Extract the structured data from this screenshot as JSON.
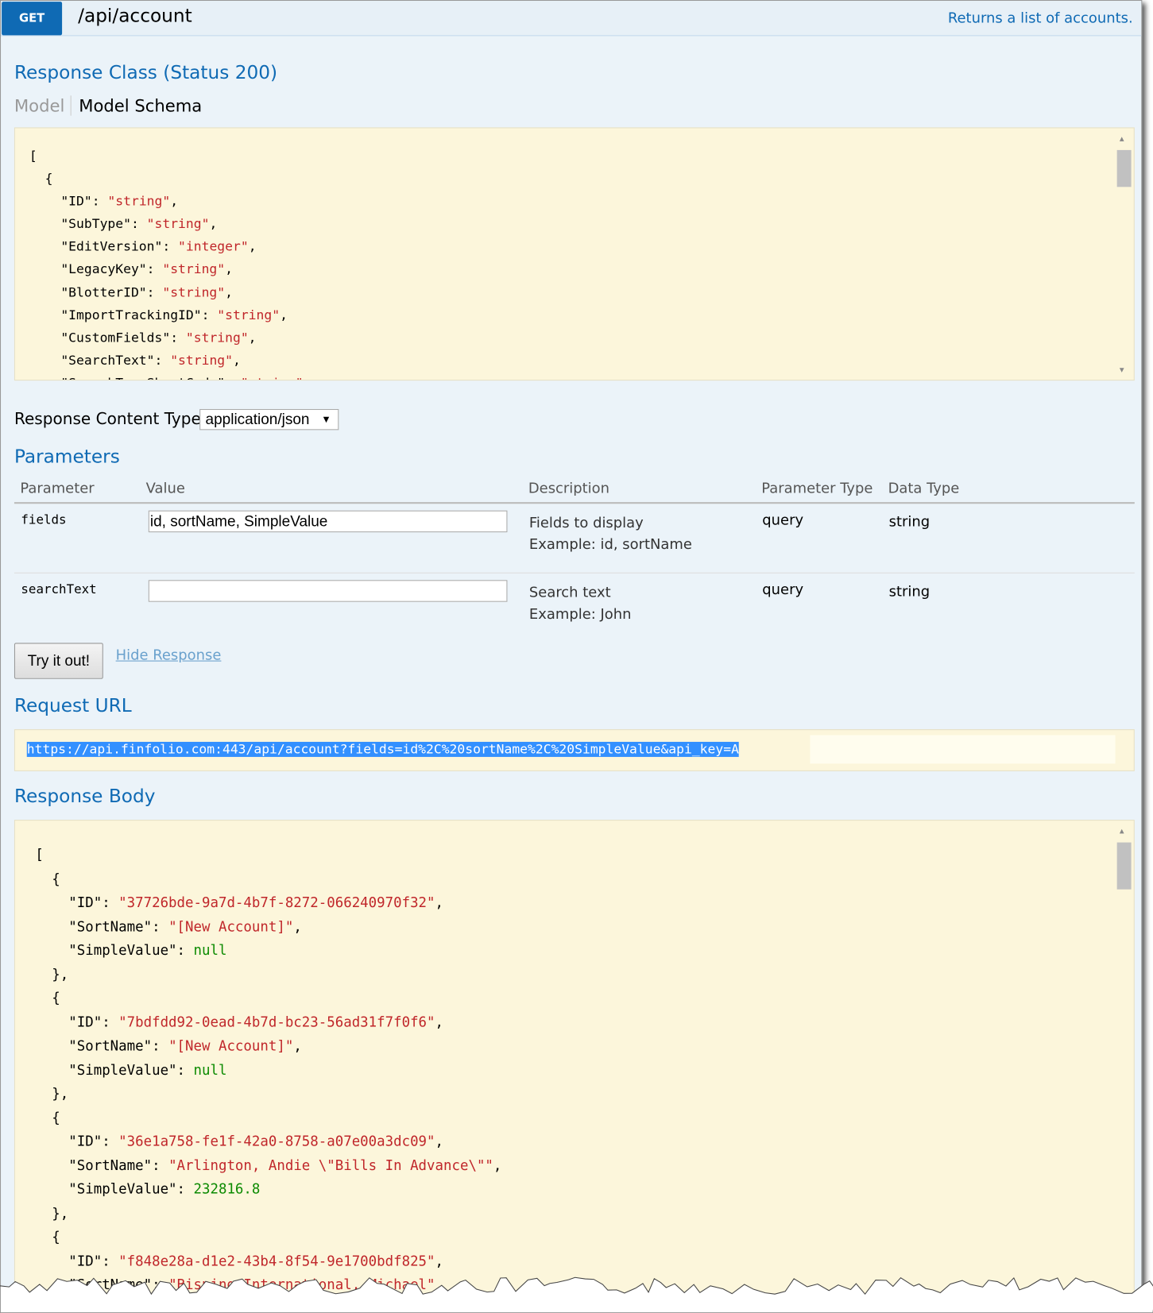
{
  "header": {
    "method": "GET",
    "path": "/api/account",
    "description": "Returns a list of accounts.",
    "method_color": "#0f6ab4"
  },
  "response_class": {
    "title": "Response Class (Status 200)",
    "tabs": [
      "Model",
      "Model Schema"
    ],
    "schema_lines": [
      [
        [
          "[",
          ""
        ]
      ],
      [
        [
          "  {",
          ""
        ]
      ],
      [
        [
          "    \"ID\": ",
          ""
        ],
        [
          "\"string\"",
          "s"
        ],
        [
          ",",
          ""
        ]
      ],
      [
        [
          "    \"SubType\": ",
          ""
        ],
        [
          "\"string\"",
          "s"
        ],
        [
          ",",
          ""
        ]
      ],
      [
        [
          "    \"EditVersion\": ",
          ""
        ],
        [
          "\"integer\"",
          "s"
        ],
        [
          ",",
          ""
        ]
      ],
      [
        [
          "    \"LegacyKey\": ",
          ""
        ],
        [
          "\"string\"",
          "s"
        ],
        [
          ",",
          ""
        ]
      ],
      [
        [
          "    \"BlotterID\": ",
          ""
        ],
        [
          "\"string\"",
          "s"
        ],
        [
          ",",
          ""
        ]
      ],
      [
        [
          "    \"ImportTrackingID\": ",
          ""
        ],
        [
          "\"string\"",
          "s"
        ],
        [
          ",",
          ""
        ]
      ],
      [
        [
          "    \"CustomFields\": ",
          ""
        ],
        [
          "\"string\"",
          "s"
        ],
        [
          ",",
          ""
        ]
      ],
      [
        [
          "    \"SearchText\": ",
          ""
        ],
        [
          "\"string\"",
          "s"
        ],
        [
          ",",
          ""
        ]
      ],
      [
        [
          "    \"SearchTypeShortCode\": ",
          ""
        ],
        [
          "\"string\"",
          "s"
        ],
        [
          ",",
          ""
        ]
      ]
    ]
  },
  "content_type": {
    "label": "Response Content Type",
    "selected": "application/json"
  },
  "parameters": {
    "title": "Parameters",
    "columns": [
      "Parameter",
      "Value",
      "Description",
      "Parameter Type",
      "Data Type"
    ],
    "rows": [
      {
        "name": "fields",
        "value": "id, sortName, SimpleValue",
        "desc1": "Fields to display",
        "desc2": "Example: id, sortName",
        "type": "query",
        "data_type": "string"
      },
      {
        "name": "searchText",
        "value": "",
        "desc1": "Search text",
        "desc2": "Example: John",
        "type": "query",
        "data_type": "string"
      }
    ]
  },
  "actions": {
    "try_label": "Try it out!",
    "hide_label": "Hide Response"
  },
  "request_url": {
    "title": "Request URL",
    "value": "https://api.finfolio.com:443/api/account?fields=id%2C%20sortName%2C%20SimpleValue&api_key=A"
  },
  "response_body": {
    "title": "Response Body",
    "lines": [
      [
        [
          "[",
          ""
        ]
      ],
      [
        [
          "  {",
          ""
        ]
      ],
      [
        [
          "    \"ID\": ",
          ""
        ],
        [
          "\"37726bde-9a7d-4b7f-8272-066240970f32\"",
          "s"
        ],
        [
          ",",
          ""
        ]
      ],
      [
        [
          "    \"SortName\": ",
          ""
        ],
        [
          "\"[New Account]\"",
          "s"
        ],
        [
          ",",
          ""
        ]
      ],
      [
        [
          "    \"SimpleValue\": ",
          ""
        ],
        [
          "null",
          "g"
        ]
      ],
      [
        [
          "  },",
          ""
        ]
      ],
      [
        [
          "  {",
          ""
        ]
      ],
      [
        [
          "    \"ID\": ",
          ""
        ],
        [
          "\"7bdfdd92-0ead-4b7d-bc23-56ad31f7f0f6\"",
          "s"
        ],
        [
          ",",
          ""
        ]
      ],
      [
        [
          "    \"SortName\": ",
          ""
        ],
        [
          "\"[New Account]\"",
          "s"
        ],
        [
          ",",
          ""
        ]
      ],
      [
        [
          "    \"SimpleValue\": ",
          ""
        ],
        [
          "null",
          "g"
        ]
      ],
      [
        [
          "  },",
          ""
        ]
      ],
      [
        [
          "  {",
          ""
        ]
      ],
      [
        [
          "    \"ID\": ",
          ""
        ],
        [
          "\"36e1a758-fe1f-42a0-8758-a07e00a3dc09\"",
          "s"
        ],
        [
          ",",
          ""
        ]
      ],
      [
        [
          "    \"SortName\": ",
          ""
        ],
        [
          "\"Arlington, Andie \\\"Bills In Advance\\\"\"",
          "s"
        ],
        [
          ",",
          ""
        ]
      ],
      [
        [
          "    \"SimpleValue\": ",
          ""
        ],
        [
          "232816.8",
          "g"
        ]
      ],
      [
        [
          "  },",
          ""
        ]
      ],
      [
        [
          "  {",
          ""
        ]
      ],
      [
        [
          "    \"ID\": ",
          ""
        ],
        [
          "\"f848e28a-d1e2-43b4-8f54-9e1700bdf825\"",
          "s"
        ],
        [
          ",",
          ""
        ]
      ],
      [
        [
          "    \"SortName\": ",
          ""
        ],
        [
          "\"Bisping International, Michael\"",
          "s"
        ],
        [
          ",",
          ""
        ]
      ]
    ]
  }
}
